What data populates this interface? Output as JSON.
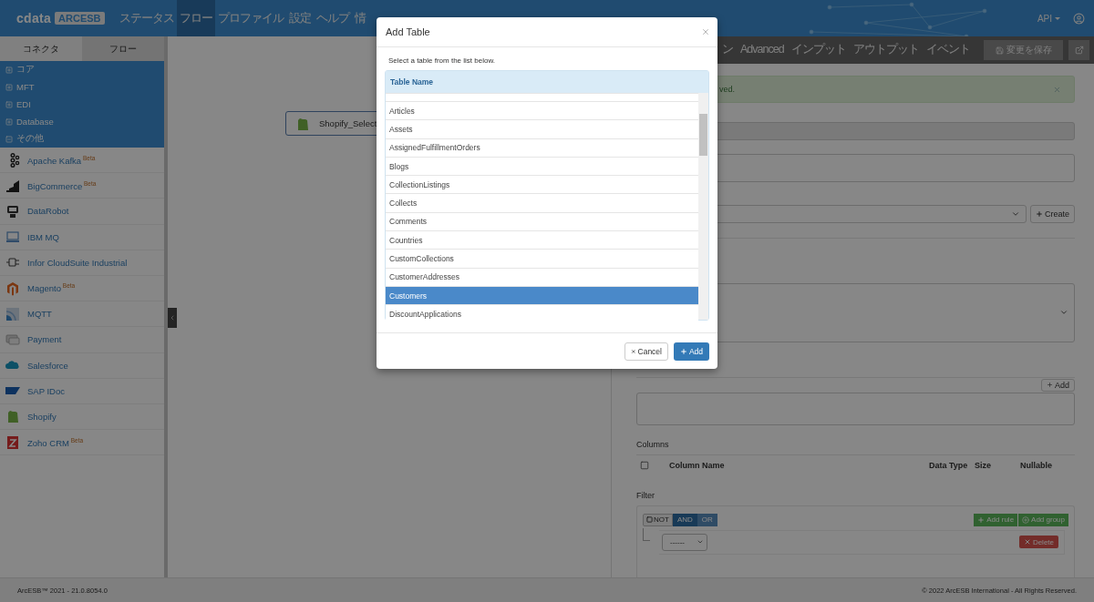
{
  "header": {
    "logo": "cdata",
    "badge": "ARCESB",
    "nav": [
      {
        "label": "ステータス",
        "selected": false
      },
      {
        "label": "フロー",
        "selected": true
      },
      {
        "label": "プロファイル",
        "selected": false
      },
      {
        "label": "設定",
        "selected": false
      },
      {
        "label": "ヘルプ",
        "selected": false
      },
      {
        "label": "情",
        "selected": false
      }
    ],
    "api_menu": "API"
  },
  "sidebar": {
    "tabs": [
      {
        "label": "コネクタ",
        "selected": true
      },
      {
        "label": "フロー",
        "selected": false
      }
    ],
    "categories": [
      {
        "label": "コア",
        "expanded": false
      },
      {
        "label": "MFT",
        "expanded": false
      },
      {
        "label": "EDI",
        "expanded": false
      },
      {
        "label": "Database",
        "expanded": false
      },
      {
        "label": "その他",
        "expanded": true
      }
    ],
    "connectors": [
      {
        "name": "Apache Kafka",
        "badge": "Beta"
      },
      {
        "name": "BigCommerce",
        "badge": "Beta"
      },
      {
        "name": "DataRobot"
      },
      {
        "name": "IBM MQ"
      },
      {
        "name": "Infor CloudSuite Industrial"
      },
      {
        "name": "Magento",
        "badge": "Beta"
      },
      {
        "name": "MQTT"
      },
      {
        "name": "Payment"
      },
      {
        "name": "Salesforce"
      },
      {
        "name": "SAP IDoc"
      },
      {
        "name": "Shopify"
      },
      {
        "name": "Zoho CRM",
        "badge": "Beta"
      }
    ]
  },
  "canvas": {
    "nodes": [
      {
        "label": "Shopify_Select"
      }
    ]
  },
  "right_panel": {
    "tabs": [
      {
        "label": "ン",
        "selected": false
      },
      {
        "label": "Advanced",
        "selected": false
      },
      {
        "label": "インプット",
        "selected": false
      },
      {
        "label": "アウトプット",
        "selected": false
      },
      {
        "label": "イベント",
        "selected": false
      }
    ],
    "save_button": "変更を保存",
    "alert": "ved.",
    "create_button": "Create",
    "add_button": "Add",
    "columns": {
      "title": "Columns",
      "select_all_checked": false,
      "headers": [
        "Column Name",
        "Data Type",
        "Size",
        "Nullable"
      ]
    },
    "filter": {
      "title": "Filter",
      "not_label": "NOT",
      "not_checked": false,
      "conditions": [
        {
          "label": "AND",
          "selected": true
        },
        {
          "label": "OR",
          "selected": false
        }
      ],
      "add_rule": "Add rule",
      "add_group": "Add group",
      "rule_select": "------",
      "delete": "Delete"
    }
  },
  "footer": {
    "version": "ArcESB™ 2021 - 21.0.8054.0",
    "copyright": "© 2022 ArcESB International - All Rights Reserved."
  },
  "modal": {
    "title": "Add Table",
    "instruction": "Select a table from the list below.",
    "column": "Table Name",
    "rows": [
      {
        "name": "Articles",
        "selected": false
      },
      {
        "name": "Assets",
        "selected": false
      },
      {
        "name": "AssignedFulfillmentOrders",
        "selected": false
      },
      {
        "name": "Blogs",
        "selected": false
      },
      {
        "name": "CollectionListings",
        "selected": false
      },
      {
        "name": "Collects",
        "selected": false
      },
      {
        "name": "Comments",
        "selected": false
      },
      {
        "name": "Countries",
        "selected": false
      },
      {
        "name": "CustomCollections",
        "selected": false
      },
      {
        "name": "CustomerAddresses",
        "selected": false
      },
      {
        "name": "Customers",
        "selected": true
      },
      {
        "name": "DiscountApplications",
        "selected": false
      }
    ],
    "cancel": "Cancel",
    "add": "Add"
  }
}
